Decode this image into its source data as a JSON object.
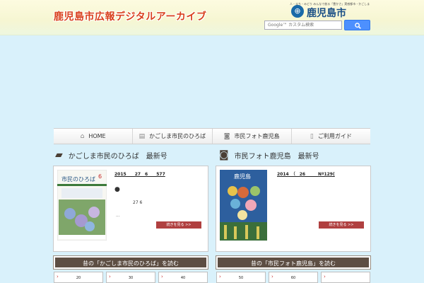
{
  "header": {
    "title": "鹿児島市広報デジタルアーカイブ",
    "logo_tagline": "人・まち・みどり みんなで創る「豊かさ」実感都市・かごしま",
    "logo_text": "鹿児島市",
    "search_placeholder": "Google™ カスタム検索",
    "search_button_icon": "search-icon"
  },
  "nav": {
    "items": [
      {
        "label": "HOME",
        "icon": "home-icon"
      },
      {
        "label": "かごしま市民のひろば",
        "icon": "magazine-icon"
      },
      {
        "label": "市民フォト鹿児島",
        "icon": "camera-icon"
      },
      {
        "label": "ご利用ガイド",
        "icon": "guide-icon"
      }
    ]
  },
  "sections": {
    "left": {
      "heading": "かごしま市民のひろば　最新号",
      "date": "2015　　27　6　　577",
      "bullet": "●",
      "line": "27 6",
      "ellipsis": "...",
      "more": "続きを見る >>",
      "thumb_title": "市民のひろば",
      "thumb_issue": "6",
      "archive": "昔の「かごしま市民のひろば」を読む",
      "years": [
        "20",
        "30",
        "40"
      ]
    },
    "right": {
      "heading": "市民フォト鹿児島　最新号",
      "date": "2014　（　26　　　Nº129(",
      "more": "続きを見る >>",
      "thumb_title": "鹿児島",
      "archive": "昔の「市民フォト鹿児島」を読む",
      "years": [
        "50",
        "60",
        ""
      ]
    }
  },
  "colors": {
    "page_bg": "#d9f1fb",
    "title_red": "#d9401d",
    "archive_bar": "#5d4e43",
    "more_button": "#b04040",
    "search_blue": "#4d90fe"
  }
}
